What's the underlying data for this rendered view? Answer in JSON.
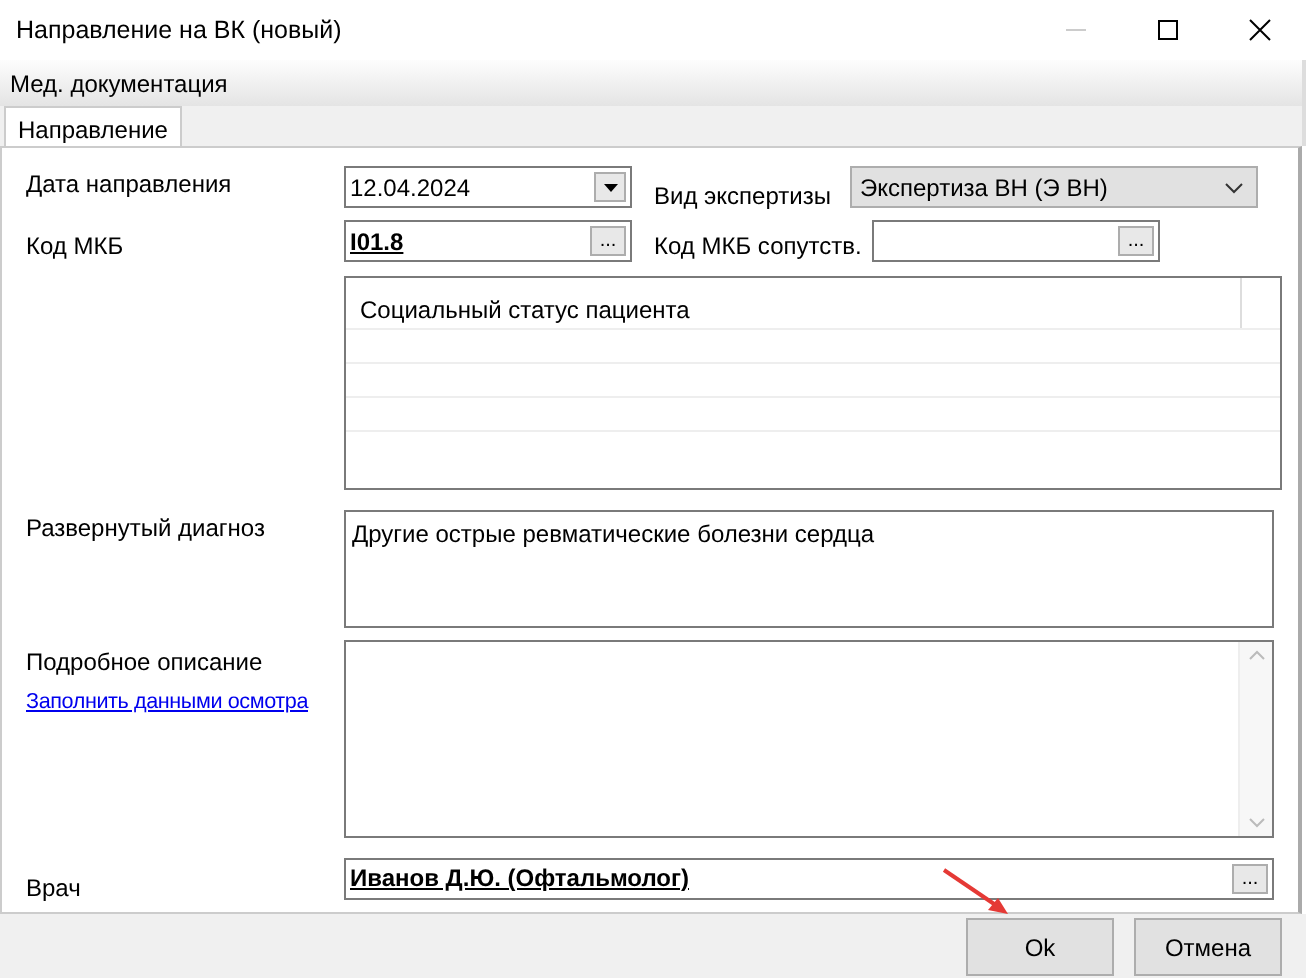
{
  "window": {
    "title": "Направление на ВК (новый)"
  },
  "menu": [
    "Мед. документация"
  ],
  "tabs": [
    {
      "label": "Направление",
      "selected": true
    }
  ],
  "referral_date": {
    "label": "Дата направления",
    "value": "12.04.2024"
  },
  "expertise_type": {
    "label": "Вид экспертизы",
    "value": "Экспертиза ВН (Э ВН)"
  },
  "icd_code": {
    "label": "Код МКБ",
    "value": "I01.8",
    "browse": "..."
  },
  "icd_secondary": {
    "label": "Код МКБ сопутств.",
    "browse": "..."
  },
  "social_status": {
    "header": "Социальный статус пациента"
  },
  "diagnosis": {
    "label": "Развернутый диагноз",
    "value": "Другие острые ревматические болезни сердца"
  },
  "description": {
    "label": "Подробное описание",
    "link": "Заполнить данными осмотра"
  },
  "doctor": {
    "label": "Врач",
    "value": "Иванов Д.Ю. (Офтальмолог)",
    "browse": "..."
  },
  "buttons": [
    "Ok",
    "Отмена"
  ]
}
